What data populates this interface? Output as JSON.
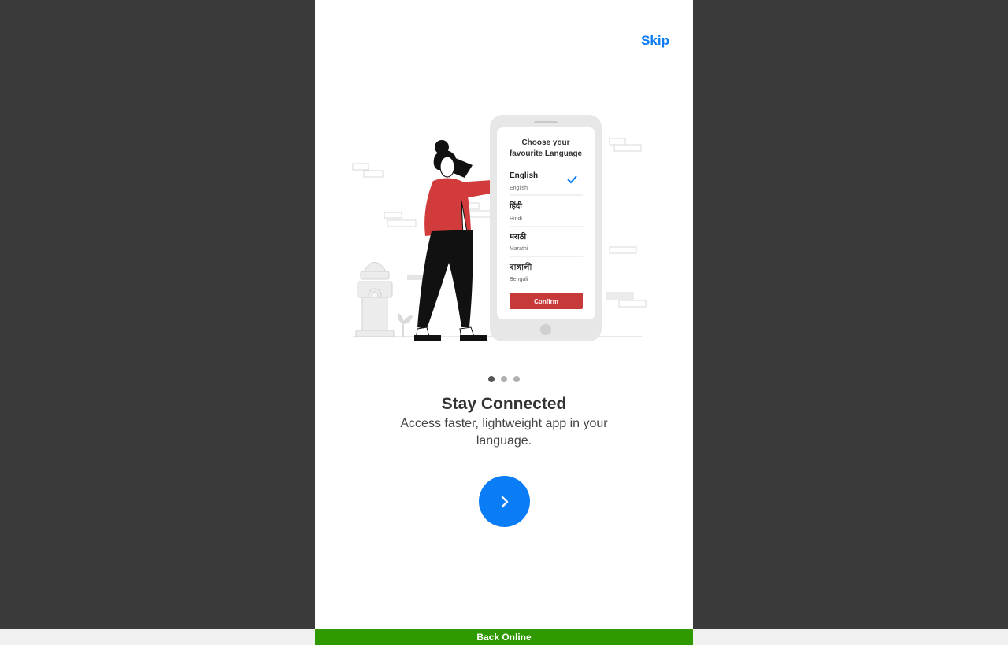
{
  "colors": {
    "accent": "#0a7cf5",
    "dot_active": "#555555",
    "dot_inactive": "#b0b0b0",
    "status_bg": "#2e9a00",
    "confirm_red": "#c73a3a",
    "jacket_red": "#d23b3b"
  },
  "header": {
    "skip_label": "Skip"
  },
  "illustration": {
    "phone": {
      "heading_line1": "Choose your",
      "heading_line2": "favourite Language",
      "languages": [
        {
          "native": "English",
          "english": "English",
          "selected": true
        },
        {
          "native": "हिंदी",
          "english": "Hindi",
          "selected": false
        },
        {
          "native": "मराठी",
          "english": "Marathi",
          "selected": false
        },
        {
          "native": "বাঙ্গালী",
          "english": "Bengali",
          "selected": false
        }
      ],
      "confirm_label": "Confirm"
    }
  },
  "pager": {
    "total": 3,
    "active_index": 0
  },
  "content": {
    "title": "Stay Connected",
    "subtitle": "Access faster, lightweight app in your language."
  },
  "next_button": {
    "icon": "chevron-right-icon"
  },
  "status": {
    "text": "Back Online"
  }
}
